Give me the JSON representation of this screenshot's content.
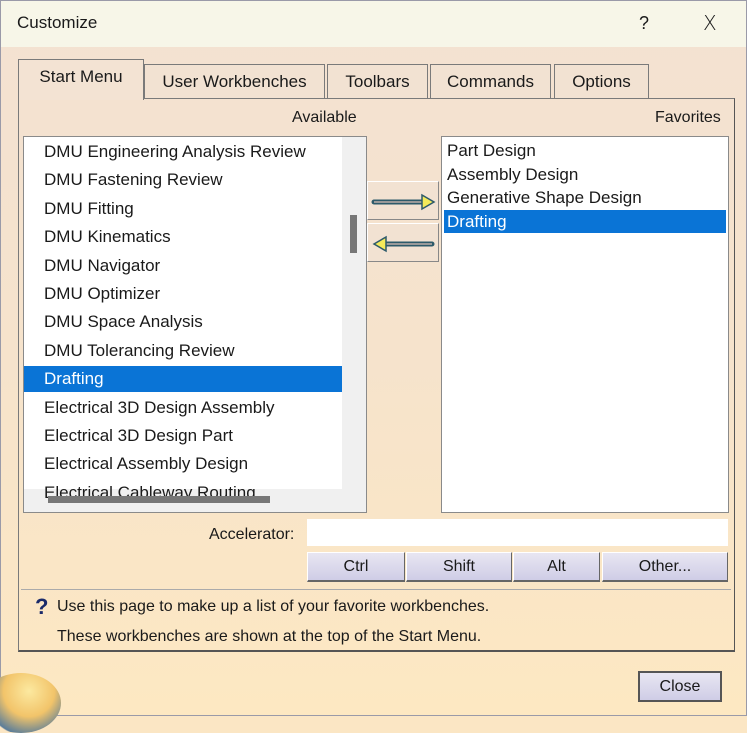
{
  "title": "Customize",
  "title_buttons": {
    "help": "?",
    "close": "X"
  },
  "tabs": [
    "Start Menu",
    "User Workbenches",
    "Toolbars",
    "Commands",
    "Options"
  ],
  "available_label": "Available",
  "favorites_label": "Favorites",
  "available": [
    "DMU Engineering Analysis Review",
    "DMU Fastening Review",
    "DMU Fitting",
    "DMU Kinematics",
    "DMU Navigator",
    "DMU Optimizer",
    "DMU Space Analysis",
    "DMU Tolerancing Review",
    "Drafting",
    "Electrical 3D Design Assembly",
    "Electrical 3D Design Part",
    "Electrical Assembly Design",
    "Electrical Cableway Routing"
  ],
  "available_selected": "Drafting",
  "favorites": [
    "Part Design",
    "Assembly Design",
    "Generative Shape Design",
    "Drafting"
  ],
  "favorites_selected": "Drafting",
  "accelerator": {
    "label": "Accelerator:",
    "value": ""
  },
  "modifier_buttons": [
    "Ctrl",
    "Shift",
    "Alt",
    "Other..."
  ],
  "help": {
    "icon": "?",
    "line1": "Use this page to make up a list of your favorite workbenches.",
    "line2": "These workbenches are shown at the top of the Start Menu."
  },
  "close_label": "Close",
  "colors": {
    "selection": "#0a74d6"
  }
}
